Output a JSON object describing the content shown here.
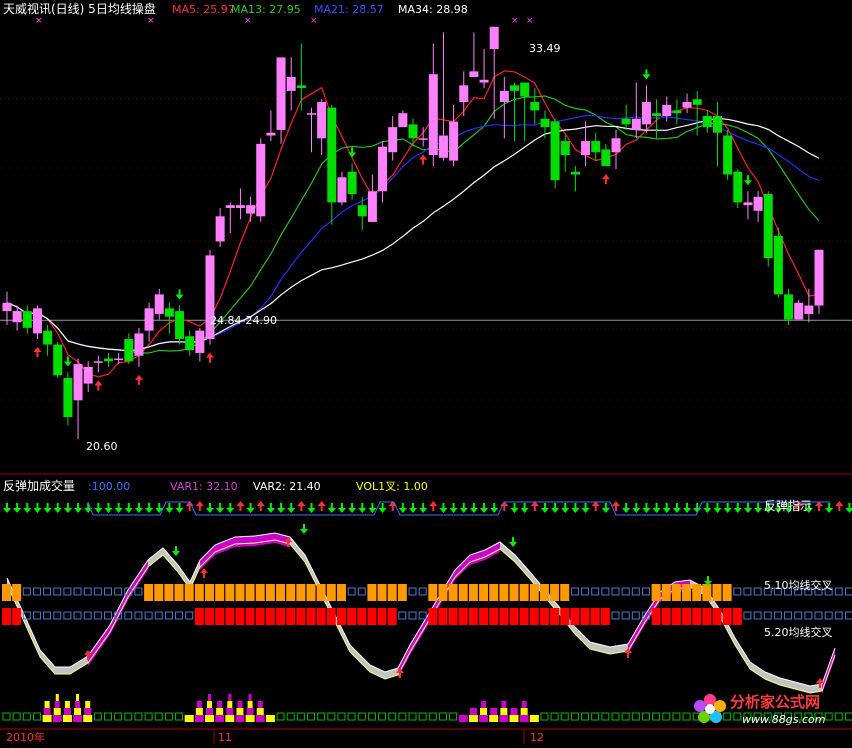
{
  "header": {
    "title": "天威视讯(日线) 5日均线操盘",
    "ma": [
      {
        "label": "MA5:",
        "value": "25.97",
        "color": "#ff3030"
      },
      {
        "label": "MA13:",
        "value": "27.95",
        "color": "#20d020"
      },
      {
        "label": "MA21:",
        "value": "28.57",
        "color": "#3050ff"
      },
      {
        "label": "MA34:",
        "value": "28.98",
        "color": "#ffffff"
      }
    ]
  },
  "subheader": {
    "title": "反弹加成交量",
    "value": ":100.00",
    "var1": "VAR1: 32.10",
    "var2": "VAR2: 21.40",
    "vol": "VOL1叉: 1.00"
  },
  "labels": {
    "high": "33.49",
    "low": "20.60",
    "range": "24.84-24.90",
    "rebound": "反弹指示",
    "cross510": "5.10均线交叉",
    "cross520": "5.20均线交叉"
  },
  "axis": {
    "x_ticks": [
      "2010年",
      "11",
      "12"
    ]
  },
  "watermark": {
    "text": "分析家公式网",
    "url": "www.88gs.com"
  },
  "colors": {
    "up": "#ff80ff",
    "down": "#00dd00",
    "ma5": "#ff2020",
    "ma13": "#20c020",
    "ma21": "#2030ff",
    "ma34": "#ffffff",
    "magenta": "#cc00cc",
    "orange": "#ff9900",
    "red_bar": "#ff0000",
    "yellow": "#ffff00",
    "arrow_up": "#ff3030",
    "arrow_down": "#00ee00",
    "square": "#4a7bd0",
    "green_sq": "#00bb00"
  },
  "chart_data": {
    "type": "candlestick",
    "price_range": [
      19.5,
      35.5
    ],
    "reference_price": 24.87,
    "candles": [
      [
        25.2,
        25.5,
        25.9,
        24.7
      ],
      [
        24.8,
        25.2,
        25.4,
        24.5
      ],
      [
        25.2,
        24.6,
        25.4,
        24.4
      ],
      [
        24.4,
        25.3,
        25.4,
        24.2
      ],
      [
        24.5,
        24.0,
        24.7,
        23.6
      ],
      [
        24.0,
        22.9,
        24.1,
        22.8
      ],
      [
        22.8,
        21.4,
        23.0,
        21.1
      ],
      [
        22.0,
        23.3,
        23.5,
        20.6
      ],
      [
        22.6,
        23.2,
        23.4,
        22.3
      ],
      [
        23.4,
        23.4,
        23.6,
        23.0
      ],
      [
        23.5,
        23.4,
        23.7,
        23.2
      ],
      [
        23.5,
        23.5,
        23.7,
        23.3
      ],
      [
        24.2,
        23.4,
        24.4,
        23.3
      ],
      [
        23.6,
        24.4,
        24.6,
        23.2
      ],
      [
        24.5,
        25.3,
        25.5,
        24.1
      ],
      [
        25.1,
        25.8,
        26.0,
        24.9
      ],
      [
        25.3,
        25.0,
        25.5,
        24.4
      ],
      [
        25.2,
        24.2,
        25.4,
        24.0
      ],
      [
        24.3,
        23.8,
        24.5,
        23.6
      ],
      [
        23.7,
        24.5,
        24.6,
        23.4
      ],
      [
        24.2,
        27.2,
        27.4,
        24.0
      ],
      [
        27.7,
        28.6,
        28.9,
        27.5
      ],
      [
        28.9,
        29.0,
        29.1,
        28.0
      ],
      [
        28.9,
        29.0,
        29.6,
        28.5
      ],
      [
        28.7,
        29.0,
        29.3,
        28.4
      ],
      [
        28.6,
        31.2,
        31.4,
        28.4
      ],
      [
        31.5,
        31.6,
        32.4,
        31.3
      ],
      [
        31.7,
        34.3,
        34.3,
        31.2
      ],
      [
        33.1,
        33.6,
        34.3,
        32.4
      ],
      [
        33.3,
        33.2,
        34.8,
        32.4
      ],
      [
        32.3,
        32.3,
        32.5,
        30.9
      ],
      [
        31.4,
        32.7,
        32.8,
        30.8
      ],
      [
        32.5,
        29.1,
        32.6,
        28.3
      ],
      [
        29.1,
        30.0,
        30.2,
        29.0
      ],
      [
        30.2,
        29.4,
        30.5,
        29.2
      ],
      [
        29.0,
        28.6,
        29.3,
        28.1
      ],
      [
        28.4,
        29.5,
        30.1,
        28.4
      ],
      [
        29.5,
        31.1,
        31.3,
        29.1
      ],
      [
        30.9,
        31.8,
        32.2,
        30.6
      ],
      [
        31.8,
        32.3,
        32.4,
        31.9
      ],
      [
        31.9,
        31.4,
        32.1,
        31.1
      ],
      [
        31.4,
        31.4,
        31.8,
        31.1
      ],
      [
        30.8,
        33.7,
        34.8,
        30.4
      ],
      [
        30.7,
        31.5,
        35.2,
        30.6
      ],
      [
        30.6,
        32.0,
        32.6,
        30.4
      ],
      [
        32.7,
        33.3,
        33.8,
        32.2
      ],
      [
        33.6,
        33.8,
        35.2,
        33.6
      ],
      [
        33.4,
        33.5,
        34.6,
        33.2
      ],
      [
        34.6,
        35.4,
        34.6,
        32.1
      ],
      [
        32.7,
        33.1,
        33.6,
        31.4
      ],
      [
        33.3,
        33.1,
        33.4,
        31.3
      ],
      [
        33.4,
        32.9,
        33.3,
        31.3
      ],
      [
        32.7,
        32.4,
        33.2,
        31.9
      ],
      [
        32.1,
        31.8,
        32.4,
        31.4
      ],
      [
        32.0,
        29.9,
        32.1,
        29.6
      ],
      [
        31.3,
        30.8,
        31.5,
        30.2
      ],
      [
        30.2,
        30.1,
        30.4,
        29.5
      ],
      [
        30.8,
        31.3,
        32.0,
        30.4
      ],
      [
        31.3,
        30.9,
        31.6,
        30.6
      ],
      [
        31.0,
        30.4,
        31.2,
        30.4
      ],
      [
        30.9,
        31.4,
        31.7,
        30.3
      ],
      [
        32.1,
        31.9,
        32.6,
        31.7
      ],
      [
        31.7,
        32.1,
        33.4,
        31.4
      ],
      [
        31.9,
        32.7,
        33.3,
        31.6
      ],
      [
        32.3,
        32.2,
        32.8,
        31.4
      ],
      [
        32.2,
        32.6,
        32.9,
        32.0
      ],
      [
        32.4,
        32.3,
        32.8,
        31.9
      ],
      [
        32.5,
        32.7,
        33.0,
        32.3
      ],
      [
        32.8,
        32.6,
        33.1,
        31.5
      ],
      [
        32.2,
        31.8,
        32.4,
        31.6
      ],
      [
        32.2,
        31.6,
        32.7,
        30.4
      ],
      [
        31.5,
        30.1,
        31.7,
        29.9
      ],
      [
        30.2,
        29.1,
        30.3,
        28.9
      ],
      [
        29.0,
        29.1,
        29.5,
        28.5
      ],
      [
        28.8,
        29.3,
        29.5,
        28.4
      ],
      [
        29.4,
        27.1,
        29.5,
        26.8
      ],
      [
        27.9,
        25.8,
        28.2,
        25.7
      ],
      [
        25.8,
        24.9,
        26.0,
        24.7
      ],
      [
        24.9,
        25.5,
        25.6,
        25.2
      ],
      [
        25.1,
        25.4,
        26.0,
        24.8
      ],
      [
        25.4,
        27.4,
        27.4,
        25.1
      ]
    ],
    "markers_up": [
      3,
      9,
      13,
      20,
      41,
      59,
      82
    ],
    "markers_down": [
      6,
      17,
      34,
      63,
      73,
      86
    ],
    "rebound_up": [
      18,
      19,
      23,
      25,
      29,
      31,
      38,
      42,
      49,
      52,
      58,
      60,
      78,
      80,
      82
    ],
    "cross_orange": [
      0,
      1,
      2,
      3,
      4,
      5,
      6,
      7,
      8,
      9,
      10,
      11,
      12,
      13,
      14,
      15,
      16,
      17,
      18,
      19,
      20,
      21,
      22,
      23,
      24,
      25,
      26,
      27,
      28,
      29,
      30,
      31,
      32,
      33,
      34,
      35,
      36,
      37,
      38,
      39,
      40,
      41,
      42,
      43,
      44,
      45,
      46,
      47,
      48,
      49,
      50,
      51,
      52,
      53,
      54,
      55,
      56,
      57,
      58,
      59,
      60,
      61,
      62,
      63,
      64,
      65,
      66,
      67,
      68,
      69,
      70,
      71,
      72,
      73,
      74,
      75,
      76,
      77,
      78,
      79,
      80,
      81,
      82
    ]
  }
}
